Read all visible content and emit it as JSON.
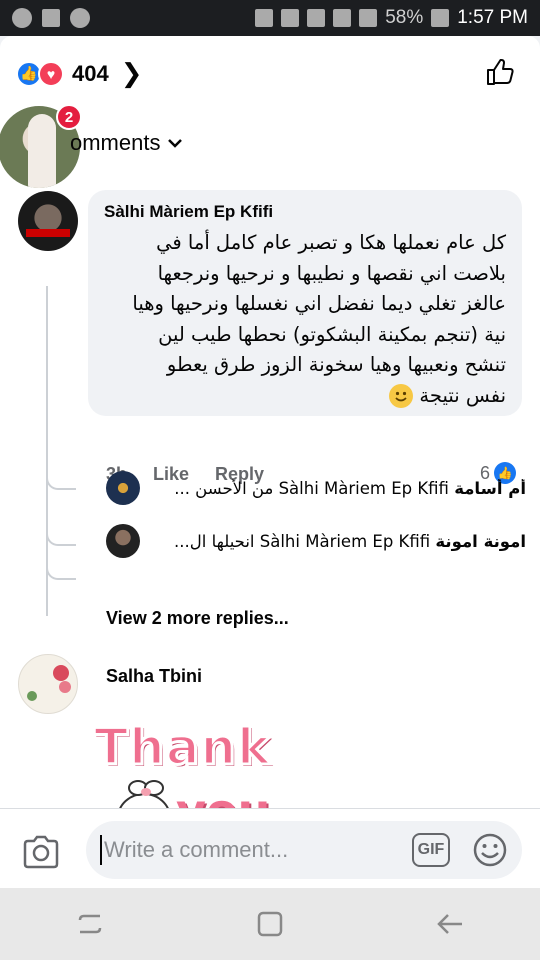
{
  "status_bar": {
    "battery": "58%",
    "time": "1:57 PM"
  },
  "header": {
    "reaction_count": "404"
  },
  "notification_badge": "2",
  "comments_sort_label": "omments",
  "main_comment": {
    "author": "Sàlhi Màriem Ep Kfifi",
    "text_lines": [
      "كل عام نعملها هكا و تصبر عام كامل أما في",
      "بلاصت اني نقصها و نطيبها و نرحيها ونرجعها",
      "عالغز تغلي  ديما نفضل اني نغسلها ونرحيها وهيا",
      "نية (تنجم بمكينة البشكوتو) نحطها طيب لين",
      "تنشح ونعبيها وهيا سخونة الزوز طرق يعطو",
      "نفس نتيجة"
    ],
    "time": "3h",
    "like_label": "Like",
    "reply_label": "Reply",
    "like_count": "6"
  },
  "replies": [
    {
      "author": "أم أسامة",
      "mention": "Sàlhi Màriem Ep Kfifi",
      "snippet": "من الأحسن ..."
    },
    {
      "author": "امونة امونة",
      "mention": "Sàlhi Màriem Ep Kfifi",
      "snippet": "انحيلها ال..."
    }
  ],
  "view_more_label": "View 2 more replies...",
  "second_comment": {
    "author": "Salha Tbini",
    "sticker_text_1": "Thank",
    "sticker_text_2": "you"
  },
  "composer": {
    "placeholder": "Write a comment...",
    "gif_label": "GIF"
  },
  "colors": {
    "accent": "#1877f2",
    "heart": "#f33e58",
    "badge": "#e41e3f"
  }
}
